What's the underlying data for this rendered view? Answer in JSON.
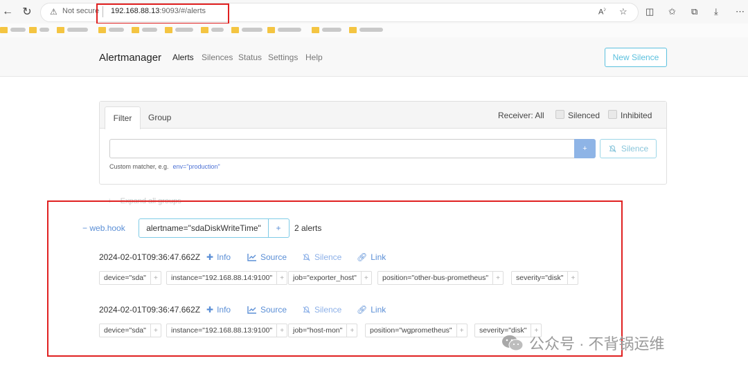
{
  "browser": {
    "security": "Not secure",
    "url_host": "192.168.88.13",
    "url_rest": ":9093/#/alerts",
    "bookmark_count": 10
  },
  "nav": {
    "brand": "Alertmanager",
    "links": [
      "Alerts",
      "Silences",
      "Status",
      "Settings",
      "Help"
    ],
    "new_silence": "New Silence"
  },
  "filter": {
    "tab_filter": "Filter",
    "tab_group": "Group",
    "receiver": "Receiver: All",
    "silenced": "Silenced",
    "inhibited": "Inhibited",
    "plus": "+",
    "silence_button": "Silence",
    "hint": "Custom matcher, e.g.",
    "hint_code": "env=\"production\""
  },
  "expand_all": "Expand all groups",
  "group": {
    "minus": "−",
    "name": "web.hook",
    "label": "alertname=\"sdaDiskWriteTime\"",
    "plus": "+",
    "count": "2 alerts"
  },
  "alerts": [
    {
      "timestamp": "2024-02-01T09:36:47.662Z",
      "actions": {
        "info": "Info",
        "source": "Source",
        "silence": "Silence",
        "link": "Link"
      },
      "labels": [
        "device=\"sda\"",
        "instance=\"192.168.88.14:9100\"",
        "job=\"exporter_host\"",
        "position=\"other-bus-prometheus\"",
        "severity=\"disk\""
      ]
    },
    {
      "timestamp": "2024-02-01T09:36:47.662Z",
      "actions": {
        "info": "Info",
        "source": "Source",
        "silence": "Silence",
        "link": "Link"
      },
      "labels": [
        "device=\"sda\"",
        "instance=\"192.168.88.13:9100\"",
        "job=\"host-mon\"",
        "position=\"wgprometheus\"",
        "severity=\"disk\""
      ]
    }
  ],
  "watermark": "公众号 · 不背锅运维",
  "colors": {
    "accent": "#5b8fd6",
    "highlight_box": "#e02020",
    "info": "#5bc0de"
  }
}
